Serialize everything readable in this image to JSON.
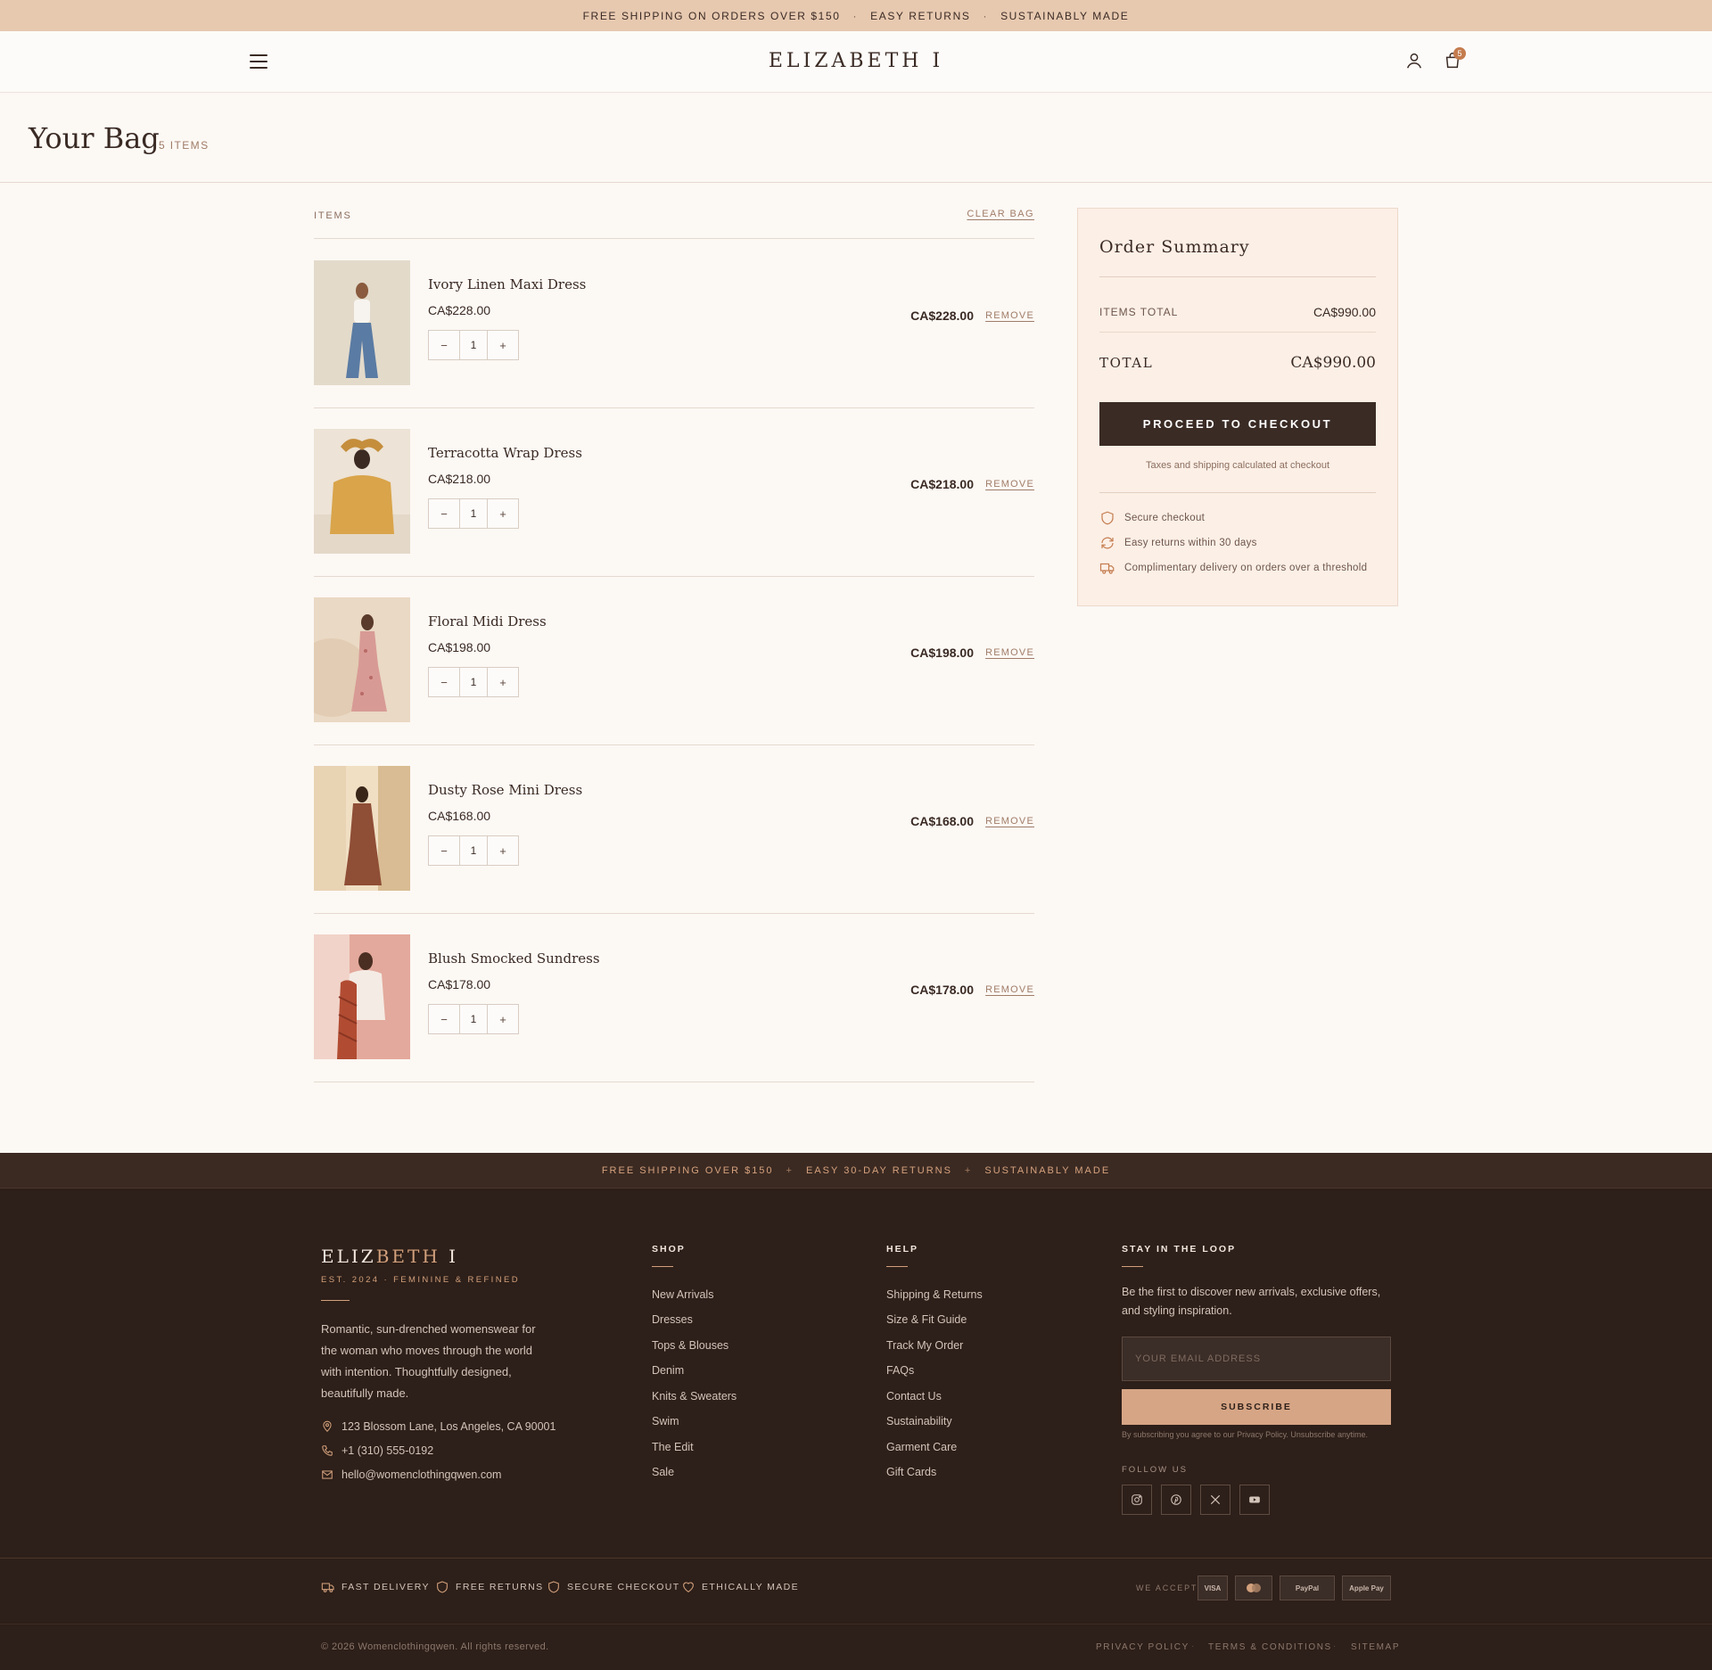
{
  "announcement": {
    "items": [
      "FREE SHIPPING ON ORDERS OVER $150",
      "EASY RETURNS",
      "SUSTAINABLY MADE"
    ],
    "separator": "·"
  },
  "header": {
    "brand": "ELIZABETH I",
    "bag_count": "5",
    "icons": [
      "hamburger-menu-icon",
      "user-icon",
      "shopping-bag-icon"
    ]
  },
  "page": {
    "title": "Your Bag",
    "item_count": "5 ITEMS"
  },
  "items_header": {
    "label": "ITEMS",
    "clear": "CLEAR BAG"
  },
  "cart": {
    "remove_label": "REMOVE",
    "decrement": "−",
    "increment": "+",
    "items": [
      {
        "name": "Ivory Linen Maxi Dress",
        "price": "CA$228.00",
        "qty": "1",
        "total": "CA$228.00"
      },
      {
        "name": "Terracotta Wrap Dress",
        "price": "CA$218.00",
        "qty": "1",
        "total": "CA$218.00"
      },
      {
        "name": "Floral Midi Dress",
        "price": "CA$198.00",
        "qty": "1",
        "total": "CA$198.00"
      },
      {
        "name": "Dusty Rose Mini Dress",
        "price": "CA$168.00",
        "qty": "1",
        "total": "CA$168.00"
      },
      {
        "name": "Blush Smocked Sundress",
        "price": "CA$178.00",
        "qty": "1",
        "total": "CA$178.00"
      }
    ]
  },
  "summary": {
    "title": "Order Summary",
    "items_total_label": "ITEMS TOTAL",
    "items_total": "CA$990.00",
    "total_label": "TOTAL",
    "total": "CA$990.00",
    "checkout": "PROCEED TO CHECKOUT",
    "tax_note": "Taxes and shipping calculated at checkout",
    "perks": [
      {
        "icon": "shield-icon",
        "text": "Secure checkout"
      },
      {
        "icon": "refresh-icon",
        "text": "Easy returns within 30 days"
      },
      {
        "icon": "truck-icon",
        "text": "Complimentary delivery on orders over a threshold"
      }
    ]
  },
  "footer": {
    "strip": [
      "FREE SHIPPING OVER $150",
      "EASY 30-DAY RETURNS",
      "SUSTAINABLY MADE"
    ],
    "strip_separator": "+",
    "logo_main": "ELIZ",
    "logo_accent": "BETH",
    "logo_end": " I",
    "tagline": "EST. 2024 · FEMININE & REFINED",
    "about": "Romantic, sun-drenched womenswear for the woman who moves through the world with intention. Thoughtfully designed, beautifully made.",
    "address": "123 Blossom Lane, Los Angeles, CA 90001",
    "phone": "+1 (310) 555-0192",
    "email": "hello@womenclothingqwen.com",
    "shop_heading": "SHOP",
    "shop_links": [
      "New Arrivals",
      "Dresses",
      "Tops & Blouses",
      "Denim",
      "Knits & Sweaters",
      "Swim",
      "The Edit",
      "Sale"
    ],
    "help_heading": "HELP",
    "help_links": [
      "Shipping & Returns",
      "Size & Fit Guide",
      "Track My Order",
      "FAQs",
      "Contact Us",
      "Sustainability",
      "Garment Care",
      "Gift Cards"
    ],
    "newsletter_heading": "STAY IN THE LOOP",
    "newsletter_text": "Be the first to discover new arrivals, exclusive offers, and styling inspiration.",
    "email_placeholder": "YOUR EMAIL ADDRESS",
    "subscribe": "SUBSCRIBE",
    "subscribe_note": "By subscribing you agree to our Privacy Policy. Unsubscribe anytime.",
    "follow": "FOLLOW US",
    "social": [
      "instagram-icon",
      "pinterest-icon",
      "x-icon",
      "youtube-icon"
    ],
    "badges": [
      {
        "icon": "truck-icon",
        "text": "FAST DELIVERY"
      },
      {
        "icon": "shield-icon",
        "text": "FREE RETURNS"
      },
      {
        "icon": "shield-icon",
        "text": "SECURE CHECKOUT"
      },
      {
        "icon": "heart-icon",
        "text": "ETHICALLY MADE"
      }
    ],
    "we_accept": "WE ACCEPT",
    "payments": [
      "VISA",
      "",
      "PayPal",
      "Apple Pay"
    ],
    "copyright": "© 2026 Womenclothingqwen. All rights reserved.",
    "legal": [
      "PRIVACY POLICY",
      "TERMS & CONDITIONS",
      "SITEMAP"
    ],
    "legal_separator": "·"
  },
  "colors": {
    "announcement_bg": "#e7c9b0",
    "page_bg": "#fcf8f4",
    "summary_bg": "#fcefe6",
    "checkout_bg": "#3a2b25",
    "footer_bg": "#2d1f19",
    "accent": "#d2a07c"
  }
}
